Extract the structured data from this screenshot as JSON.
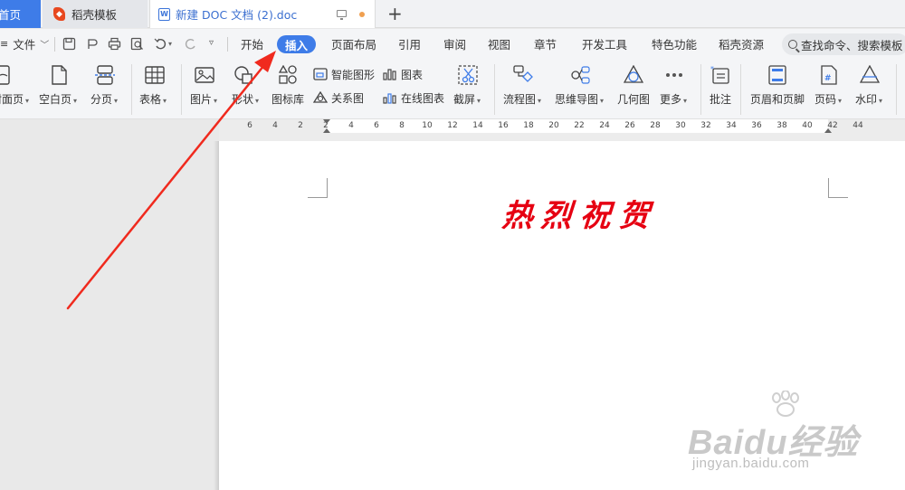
{
  "tabs": {
    "home": "首页",
    "template": "稻壳模板",
    "doc": "新建 DOC 文档 (2).doc"
  },
  "menu": {
    "file": "文件",
    "tabs": [
      "开始",
      "插入",
      "页面布局",
      "引用",
      "审阅",
      "视图",
      "章节",
      "开发工具",
      "特色功能",
      "稻壳资源"
    ],
    "active_tab": "插入",
    "search_placeholder": "查找命令、搜索模板"
  },
  "ribbon": {
    "cover_page": "封面页",
    "blank_page": "空白页",
    "page_break": "分页",
    "table": "表格",
    "picture": "图片",
    "shapes": "形状",
    "icon_library": "图标库",
    "smart_graphic": "智能图形",
    "relationship_chart": "关系图",
    "chart": "图表",
    "online_chart": "在线图表",
    "screenshot": "截屏",
    "flowchart": "流程图",
    "mind_map": "思维导图",
    "geometry": "几何图",
    "more": "更多",
    "comment": "批注",
    "header_footer": "页眉和页脚",
    "page_number": "页码",
    "watermark": "水印"
  },
  "ruler": {
    "labels": [
      "6",
      "4",
      "2",
      "2",
      "4",
      "6",
      "8",
      "10",
      "12",
      "14",
      "16",
      "18",
      "20",
      "22",
      "24",
      "26",
      "28",
      "30",
      "32",
      "34",
      "36",
      "38",
      "40",
      "42",
      "44"
    ]
  },
  "document": {
    "title": "热烈祝贺"
  },
  "watermark": {
    "brand": "Baidu经验",
    "url": "jingyan.baidu.com"
  },
  "colors": {
    "accent": "#3e7ce8",
    "title_red": "#e60012",
    "arrow_red": "#f02a1e"
  }
}
